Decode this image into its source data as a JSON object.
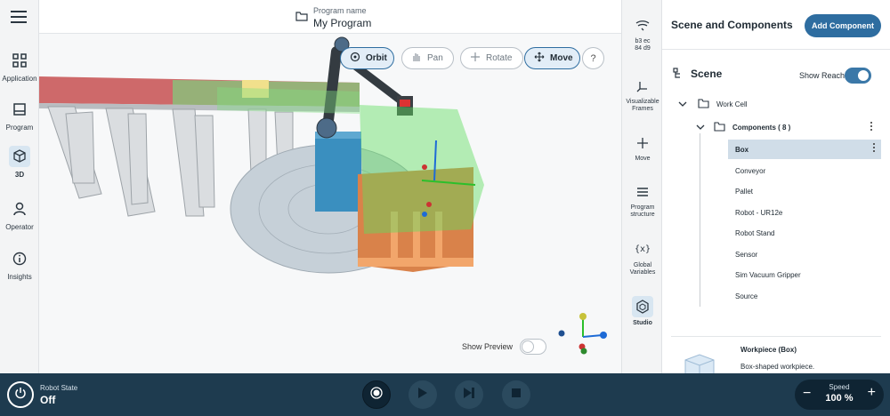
{
  "header": {
    "program_label": "Program name",
    "program_name": "My Program"
  },
  "leftnav": {
    "items": [
      {
        "label": "Application",
        "icon": "grid-icon"
      },
      {
        "label": "Program",
        "icon": "program-icon"
      },
      {
        "label": "3D",
        "icon": "cube-icon",
        "active": true
      },
      {
        "label": "Operator",
        "icon": "person-icon"
      },
      {
        "label": "Insights",
        "icon": "info-icon"
      }
    ]
  },
  "viewport": {
    "tools": [
      {
        "label": "Orbit",
        "icon": "orbit-icon",
        "active": true
      },
      {
        "label": "Pan",
        "icon": "hand-icon",
        "active": false
      },
      {
        "label": "Rotate",
        "icon": "rotate-icon",
        "active": false
      },
      {
        "label": "Move",
        "icon": "move-icon",
        "active": true
      }
    ],
    "help": "?",
    "show_preview_label": "Show Preview",
    "show_preview_on": false,
    "accent": "#2e6da0"
  },
  "toolstrip": {
    "items": [
      {
        "label": "b3 ec\n84 d9",
        "icon": "signal-icon"
      },
      {
        "label": "Visualizable Frames",
        "icon": "frames-icon"
      },
      {
        "label": "Move",
        "icon": "move-icon"
      },
      {
        "label": "Program structure",
        "icon": "list-icon"
      },
      {
        "label": "Global Variables",
        "icon": "variables-icon"
      },
      {
        "label": "Studio",
        "icon": "studio-icon",
        "active": true
      }
    ]
  },
  "panel": {
    "title": "Scene and Components",
    "add_button": "Add Component",
    "scene_title": "Scene",
    "show_reach_label": "Show Reach",
    "show_reach_on": true,
    "work_cell": "Work Cell",
    "components_label": "Components ( 8 )",
    "components": [
      "Box",
      "Conveyor",
      "Pallet",
      "Robot - UR12e",
      "Robot Stand",
      "Sensor",
      "Sim Vacuum Gripper",
      "Source"
    ],
    "selected": "Box",
    "workpiece_title": "Workpiece (Box)",
    "workpiece_desc": "Box-shaped workpiece."
  },
  "bottombar": {
    "robot_state_label": "Robot State",
    "robot_state_value": "Off",
    "speed_label": "Speed",
    "speed_value": "100 %",
    "minus": "−",
    "plus": "+"
  }
}
